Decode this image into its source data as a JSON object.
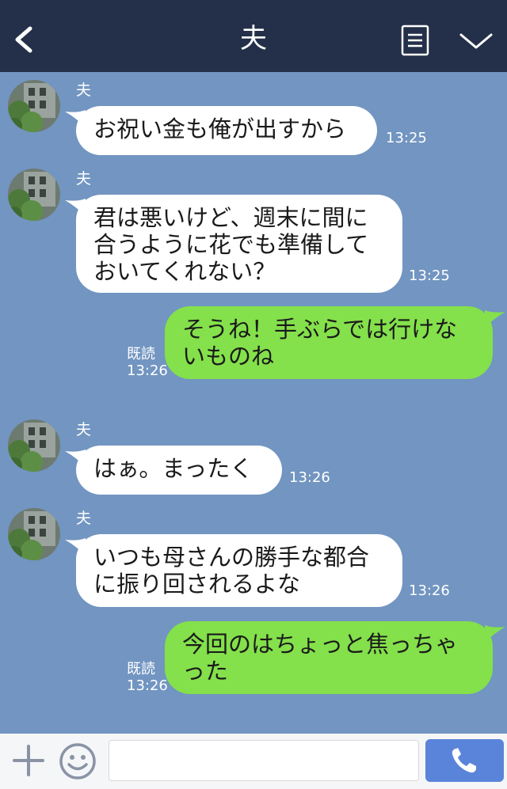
{
  "header": {
    "title": "夫",
    "background": "#243049",
    "back_icon": "chevron-left-icon",
    "menu_icon": "list-icon",
    "collapse_icon": "chevron-down-icon"
  },
  "chat": {
    "background": "#7295c1",
    "messages": [
      {
        "direction": "in",
        "sender": "夫",
        "text": "お祝い金も俺が出すから",
        "time": "13:25"
      },
      {
        "direction": "in",
        "sender": "夫",
        "text": "君は悪いけど、週末に間に\n合うように花でも準備して\nおいてくれない？",
        "time": "13:25"
      },
      {
        "direction": "out",
        "read": "既読",
        "text": "そうね！手ぶらでは行けな\nいものね",
        "time": "13:26"
      },
      {
        "direction": "in",
        "sender": "夫",
        "text": "はぁ。まったく",
        "time": "13:26"
      },
      {
        "direction": "in",
        "sender": "夫",
        "text": "いつも母さんの勝手な都合\nに振り回されるよな",
        "time": "13:26"
      },
      {
        "direction": "out",
        "read": "既読",
        "text": "今回のはちょっと焦っちゃ\nった",
        "time": "13:26"
      }
    ]
  },
  "footer": {
    "add_icon": "plus-icon",
    "sticker_icon": "smile-icon",
    "input_value": "",
    "call_icon": "phone-icon",
    "call_color": "#5a84d9"
  },
  "colors": {
    "bubble_in": "#ffffff",
    "bubble_out": "#84e04b"
  }
}
